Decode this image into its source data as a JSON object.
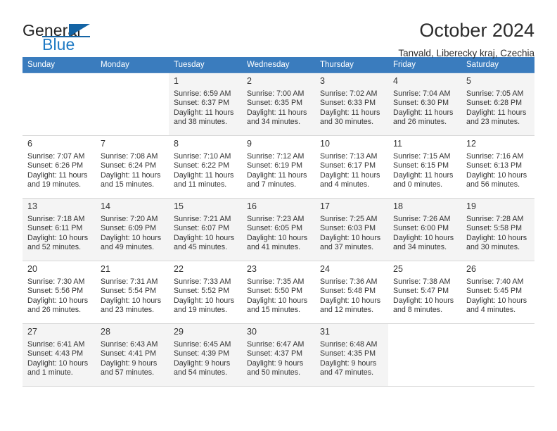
{
  "brand": {
    "name_top": "General",
    "name_bottom": "Blue",
    "flag_icon": "blue-triangle-flag-icon",
    "accent_color": "#1464a5",
    "text_color": "#222222"
  },
  "header": {
    "title": "October 2024",
    "location": "Tanvald, Liberecky kraj, Czechia"
  },
  "calendar": {
    "header_bg": "#3a7cbe",
    "header_text_color": "#ffffff",
    "weekday_headers": [
      "Sunday",
      "Monday",
      "Tuesday",
      "Wednesday",
      "Thursday",
      "Friday",
      "Saturday"
    ],
    "weeks": [
      [
        {
          "day": "",
          "sunrise": "",
          "sunset": "",
          "daylight_line1": "",
          "daylight_line2": ""
        },
        {
          "day": "",
          "sunrise": "",
          "sunset": "",
          "daylight_line1": "",
          "daylight_line2": ""
        },
        {
          "day": "1",
          "sunrise": "Sunrise: 6:59 AM",
          "sunset": "Sunset: 6:37 PM",
          "daylight_line1": "Daylight: 11 hours",
          "daylight_line2": "and 38 minutes."
        },
        {
          "day": "2",
          "sunrise": "Sunrise: 7:00 AM",
          "sunset": "Sunset: 6:35 PM",
          "daylight_line1": "Daylight: 11 hours",
          "daylight_line2": "and 34 minutes."
        },
        {
          "day": "3",
          "sunrise": "Sunrise: 7:02 AM",
          "sunset": "Sunset: 6:33 PM",
          "daylight_line1": "Daylight: 11 hours",
          "daylight_line2": "and 30 minutes."
        },
        {
          "day": "4",
          "sunrise": "Sunrise: 7:04 AM",
          "sunset": "Sunset: 6:30 PM",
          "daylight_line1": "Daylight: 11 hours",
          "daylight_line2": "and 26 minutes."
        },
        {
          "day": "5",
          "sunrise": "Sunrise: 7:05 AM",
          "sunset": "Sunset: 6:28 PM",
          "daylight_line1": "Daylight: 11 hours",
          "daylight_line2": "and 23 minutes."
        }
      ],
      [
        {
          "day": "6",
          "sunrise": "Sunrise: 7:07 AM",
          "sunset": "Sunset: 6:26 PM",
          "daylight_line1": "Daylight: 11 hours",
          "daylight_line2": "and 19 minutes."
        },
        {
          "day": "7",
          "sunrise": "Sunrise: 7:08 AM",
          "sunset": "Sunset: 6:24 PM",
          "daylight_line1": "Daylight: 11 hours",
          "daylight_line2": "and 15 minutes."
        },
        {
          "day": "8",
          "sunrise": "Sunrise: 7:10 AM",
          "sunset": "Sunset: 6:22 PM",
          "daylight_line1": "Daylight: 11 hours",
          "daylight_line2": "and 11 minutes."
        },
        {
          "day": "9",
          "sunrise": "Sunrise: 7:12 AM",
          "sunset": "Sunset: 6:19 PM",
          "daylight_line1": "Daylight: 11 hours",
          "daylight_line2": "and 7 minutes."
        },
        {
          "day": "10",
          "sunrise": "Sunrise: 7:13 AM",
          "sunset": "Sunset: 6:17 PM",
          "daylight_line1": "Daylight: 11 hours",
          "daylight_line2": "and 4 minutes."
        },
        {
          "day": "11",
          "sunrise": "Sunrise: 7:15 AM",
          "sunset": "Sunset: 6:15 PM",
          "daylight_line1": "Daylight: 11 hours",
          "daylight_line2": "and 0 minutes."
        },
        {
          "day": "12",
          "sunrise": "Sunrise: 7:16 AM",
          "sunset": "Sunset: 6:13 PM",
          "daylight_line1": "Daylight: 10 hours",
          "daylight_line2": "and 56 minutes."
        }
      ],
      [
        {
          "day": "13",
          "sunrise": "Sunrise: 7:18 AM",
          "sunset": "Sunset: 6:11 PM",
          "daylight_line1": "Daylight: 10 hours",
          "daylight_line2": "and 52 minutes."
        },
        {
          "day": "14",
          "sunrise": "Sunrise: 7:20 AM",
          "sunset": "Sunset: 6:09 PM",
          "daylight_line1": "Daylight: 10 hours",
          "daylight_line2": "and 49 minutes."
        },
        {
          "day": "15",
          "sunrise": "Sunrise: 7:21 AM",
          "sunset": "Sunset: 6:07 PM",
          "daylight_line1": "Daylight: 10 hours",
          "daylight_line2": "and 45 minutes."
        },
        {
          "day": "16",
          "sunrise": "Sunrise: 7:23 AM",
          "sunset": "Sunset: 6:05 PM",
          "daylight_line1": "Daylight: 10 hours",
          "daylight_line2": "and 41 minutes."
        },
        {
          "day": "17",
          "sunrise": "Sunrise: 7:25 AM",
          "sunset": "Sunset: 6:03 PM",
          "daylight_line1": "Daylight: 10 hours",
          "daylight_line2": "and 37 minutes."
        },
        {
          "day": "18",
          "sunrise": "Sunrise: 7:26 AM",
          "sunset": "Sunset: 6:00 PM",
          "daylight_line1": "Daylight: 10 hours",
          "daylight_line2": "and 34 minutes."
        },
        {
          "day": "19",
          "sunrise": "Sunrise: 7:28 AM",
          "sunset": "Sunset: 5:58 PM",
          "daylight_line1": "Daylight: 10 hours",
          "daylight_line2": "and 30 minutes."
        }
      ],
      [
        {
          "day": "20",
          "sunrise": "Sunrise: 7:30 AM",
          "sunset": "Sunset: 5:56 PM",
          "daylight_line1": "Daylight: 10 hours",
          "daylight_line2": "and 26 minutes."
        },
        {
          "day": "21",
          "sunrise": "Sunrise: 7:31 AM",
          "sunset": "Sunset: 5:54 PM",
          "daylight_line1": "Daylight: 10 hours",
          "daylight_line2": "and 23 minutes."
        },
        {
          "day": "22",
          "sunrise": "Sunrise: 7:33 AM",
          "sunset": "Sunset: 5:52 PM",
          "daylight_line1": "Daylight: 10 hours",
          "daylight_line2": "and 19 minutes."
        },
        {
          "day": "23",
          "sunrise": "Sunrise: 7:35 AM",
          "sunset": "Sunset: 5:50 PM",
          "daylight_line1": "Daylight: 10 hours",
          "daylight_line2": "and 15 minutes."
        },
        {
          "day": "24",
          "sunrise": "Sunrise: 7:36 AM",
          "sunset": "Sunset: 5:48 PM",
          "daylight_line1": "Daylight: 10 hours",
          "daylight_line2": "and 12 minutes."
        },
        {
          "day": "25",
          "sunrise": "Sunrise: 7:38 AM",
          "sunset": "Sunset: 5:47 PM",
          "daylight_line1": "Daylight: 10 hours",
          "daylight_line2": "and 8 minutes."
        },
        {
          "day": "26",
          "sunrise": "Sunrise: 7:40 AM",
          "sunset": "Sunset: 5:45 PM",
          "daylight_line1": "Daylight: 10 hours",
          "daylight_line2": "and 4 minutes."
        }
      ],
      [
        {
          "day": "27",
          "sunrise": "Sunrise: 6:41 AM",
          "sunset": "Sunset: 4:43 PM",
          "daylight_line1": "Daylight: 10 hours",
          "daylight_line2": "and 1 minute."
        },
        {
          "day": "28",
          "sunrise": "Sunrise: 6:43 AM",
          "sunset": "Sunset: 4:41 PM",
          "daylight_line1": "Daylight: 9 hours",
          "daylight_line2": "and 57 minutes."
        },
        {
          "day": "29",
          "sunrise": "Sunrise: 6:45 AM",
          "sunset": "Sunset: 4:39 PM",
          "daylight_line1": "Daylight: 9 hours",
          "daylight_line2": "and 54 minutes."
        },
        {
          "day": "30",
          "sunrise": "Sunrise: 6:47 AM",
          "sunset": "Sunset: 4:37 PM",
          "daylight_line1": "Daylight: 9 hours",
          "daylight_line2": "and 50 minutes."
        },
        {
          "day": "31",
          "sunrise": "Sunrise: 6:48 AM",
          "sunset": "Sunset: 4:35 PM",
          "daylight_line1": "Daylight: 9 hours",
          "daylight_line2": "and 47 minutes."
        },
        {
          "day": "",
          "sunrise": "",
          "sunset": "",
          "daylight_line1": "",
          "daylight_line2": ""
        },
        {
          "day": "",
          "sunrise": "",
          "sunset": "",
          "daylight_line1": "",
          "daylight_line2": ""
        }
      ]
    ]
  }
}
